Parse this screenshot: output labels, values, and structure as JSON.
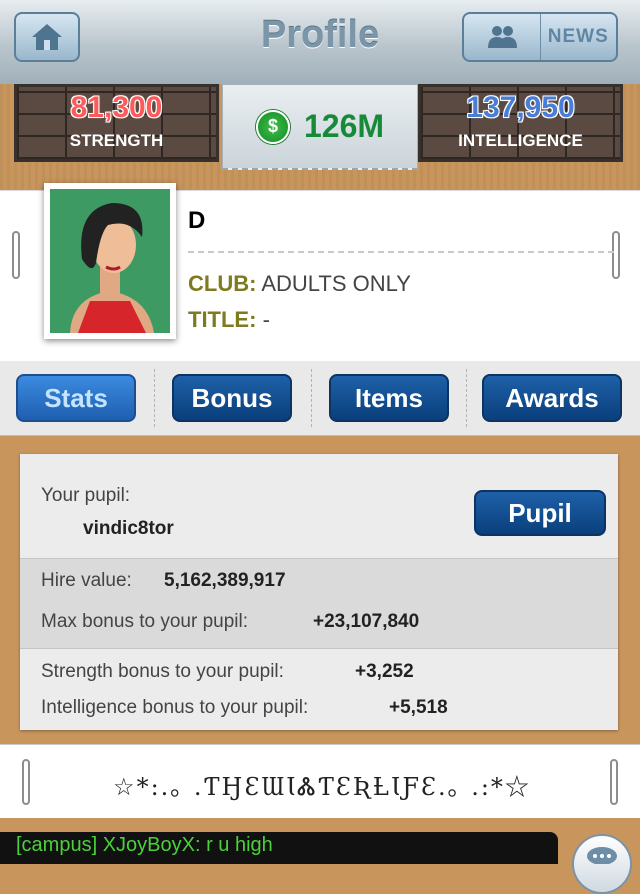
{
  "header": {
    "title": "Profile",
    "news_label": "NEWS",
    "home_icon": "home-icon",
    "friends_icon": "people-icon"
  },
  "stats": {
    "strength": {
      "value": "81,300",
      "label": "STRENGTH",
      "color": "#ff5a5a"
    },
    "cash": {
      "symbol": "$",
      "value": "126M"
    },
    "intelligence": {
      "value": "137,950",
      "label": "INTELLIGENCE",
      "color": "#4a7dd6"
    }
  },
  "profile": {
    "name": "D",
    "club_key": "CLUB:",
    "club_value": "ADULTS ONLY",
    "title_key": "TITLE:",
    "title_value": "-"
  },
  "tabs": [
    {
      "label": "Stats",
      "active": true
    },
    {
      "label": "Bonus",
      "active": false
    },
    {
      "label": "Items",
      "active": false
    },
    {
      "label": "Awards",
      "active": false
    }
  ],
  "pupil": {
    "your_pupil_label": "Your pupil:",
    "pupil_name": "vindic8tor",
    "button_label": "Pupil",
    "hire_label": "Hire value:",
    "hire_value": "5,162,389,917",
    "max_bonus_label": "Max bonus to your pupil:",
    "max_bonus_value": "+23,107,840",
    "strength_bonus_label": "Strength bonus to your pupil:",
    "strength_bonus_value": "+3,252",
    "intel_bonus_label": "Intelligence bonus to your pupil:",
    "intel_bonus_value": "+5,518"
  },
  "motto": "☆*:.｡ .ƬӇƐƜƖᏜƬƐƦȽƖƑƐ.｡ .:*☆",
  "chat": {
    "line": "[campus] XJoyBoyX: r u high",
    "icon": "chat-bubble-icon"
  }
}
